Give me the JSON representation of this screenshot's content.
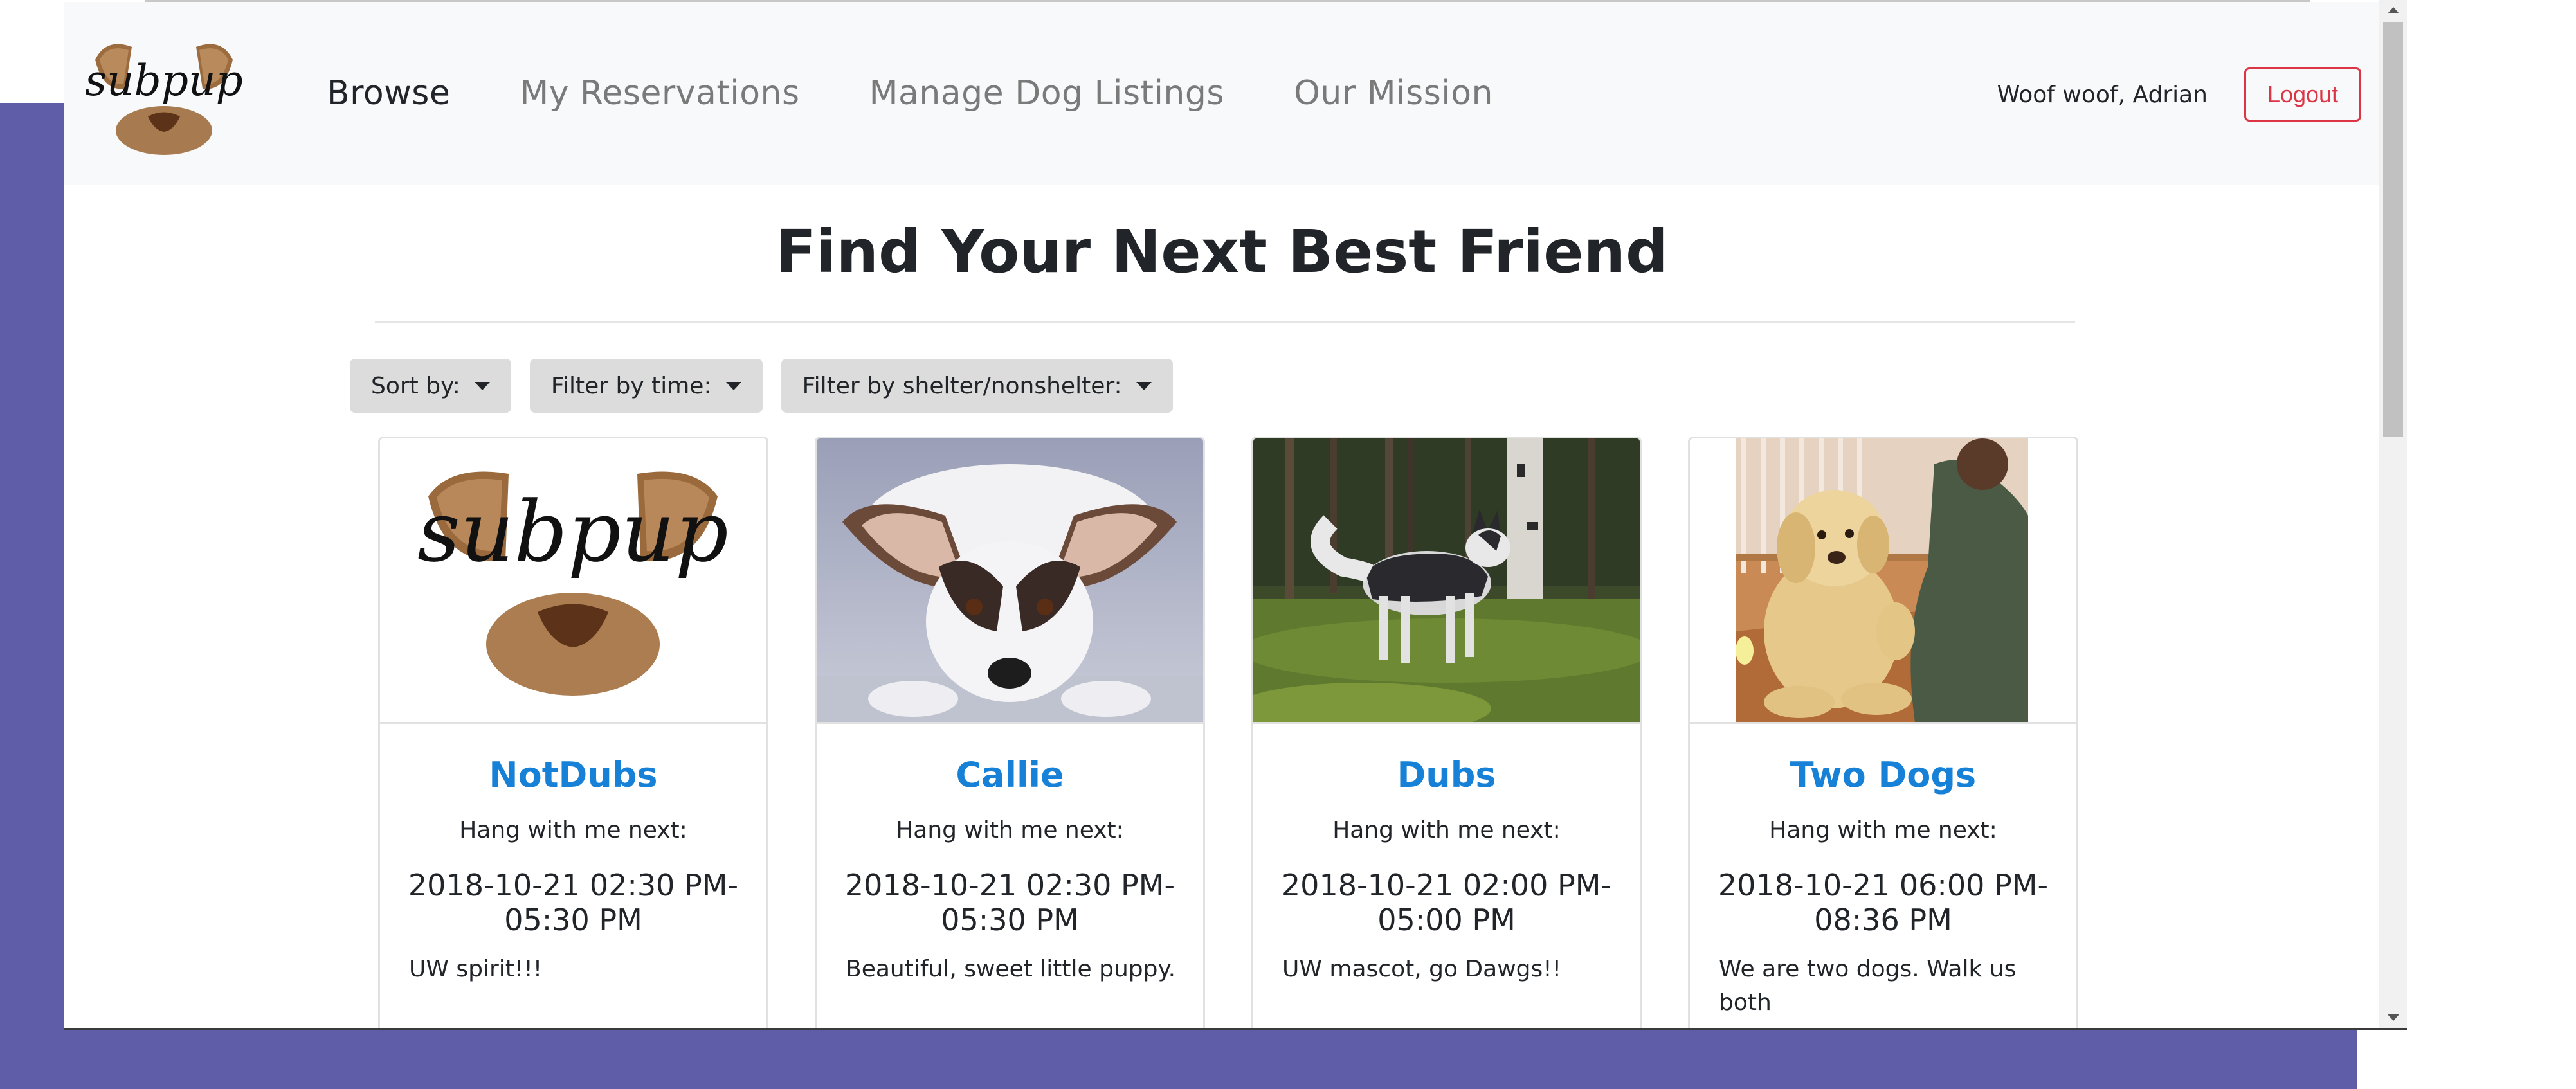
{
  "header": {
    "logo_text": "subpup",
    "nav": [
      {
        "label": "Browse",
        "active": true
      },
      {
        "label": "My Reservations",
        "active": false
      },
      {
        "label": "Manage Dog Listings",
        "active": false
      },
      {
        "label": "Our Mission",
        "active": false
      }
    ],
    "greeting": "Woof woof, Adrian",
    "logout_label": "Logout"
  },
  "main": {
    "title": "Find Your Next Best Friend",
    "filters": [
      {
        "label": "Sort by:"
      },
      {
        "label": "Filter by time:"
      },
      {
        "label": "Filter by shelter/nonshelter:"
      }
    ],
    "cards": [
      {
        "name": "NotDubs",
        "label": "Hang with me next:",
        "time": "2018-10-21 02:30 PM-05:30 PM",
        "description": "UW spirit!!!",
        "image": "subpup-logo"
      },
      {
        "name": "Callie",
        "label": "Hang with me next:",
        "time": "2018-10-21 02:30 PM-05:30 PM",
        "description": "Beautiful, sweet little puppy.",
        "image": "dog-lying-down-photo"
      },
      {
        "name": "Dubs",
        "label": "Hang with me next:",
        "time": "2018-10-21 02:00 PM-05:00 PM",
        "description": "UW mascot, go Dawgs!!",
        "image": "husky-in-forest-photo"
      },
      {
        "name": "Two Dogs",
        "label": "Hang with me next:",
        "time": "2018-10-21 06:00 PM-08:36 PM",
        "description": "We are two dogs. Walk us both",
        "image": "golden-puppy-photo"
      }
    ]
  },
  "colors": {
    "accent": "#1681d6",
    "logout": "#dc3545",
    "background_purple": "#5f5ca8",
    "navbar": "#f8f9fa"
  }
}
